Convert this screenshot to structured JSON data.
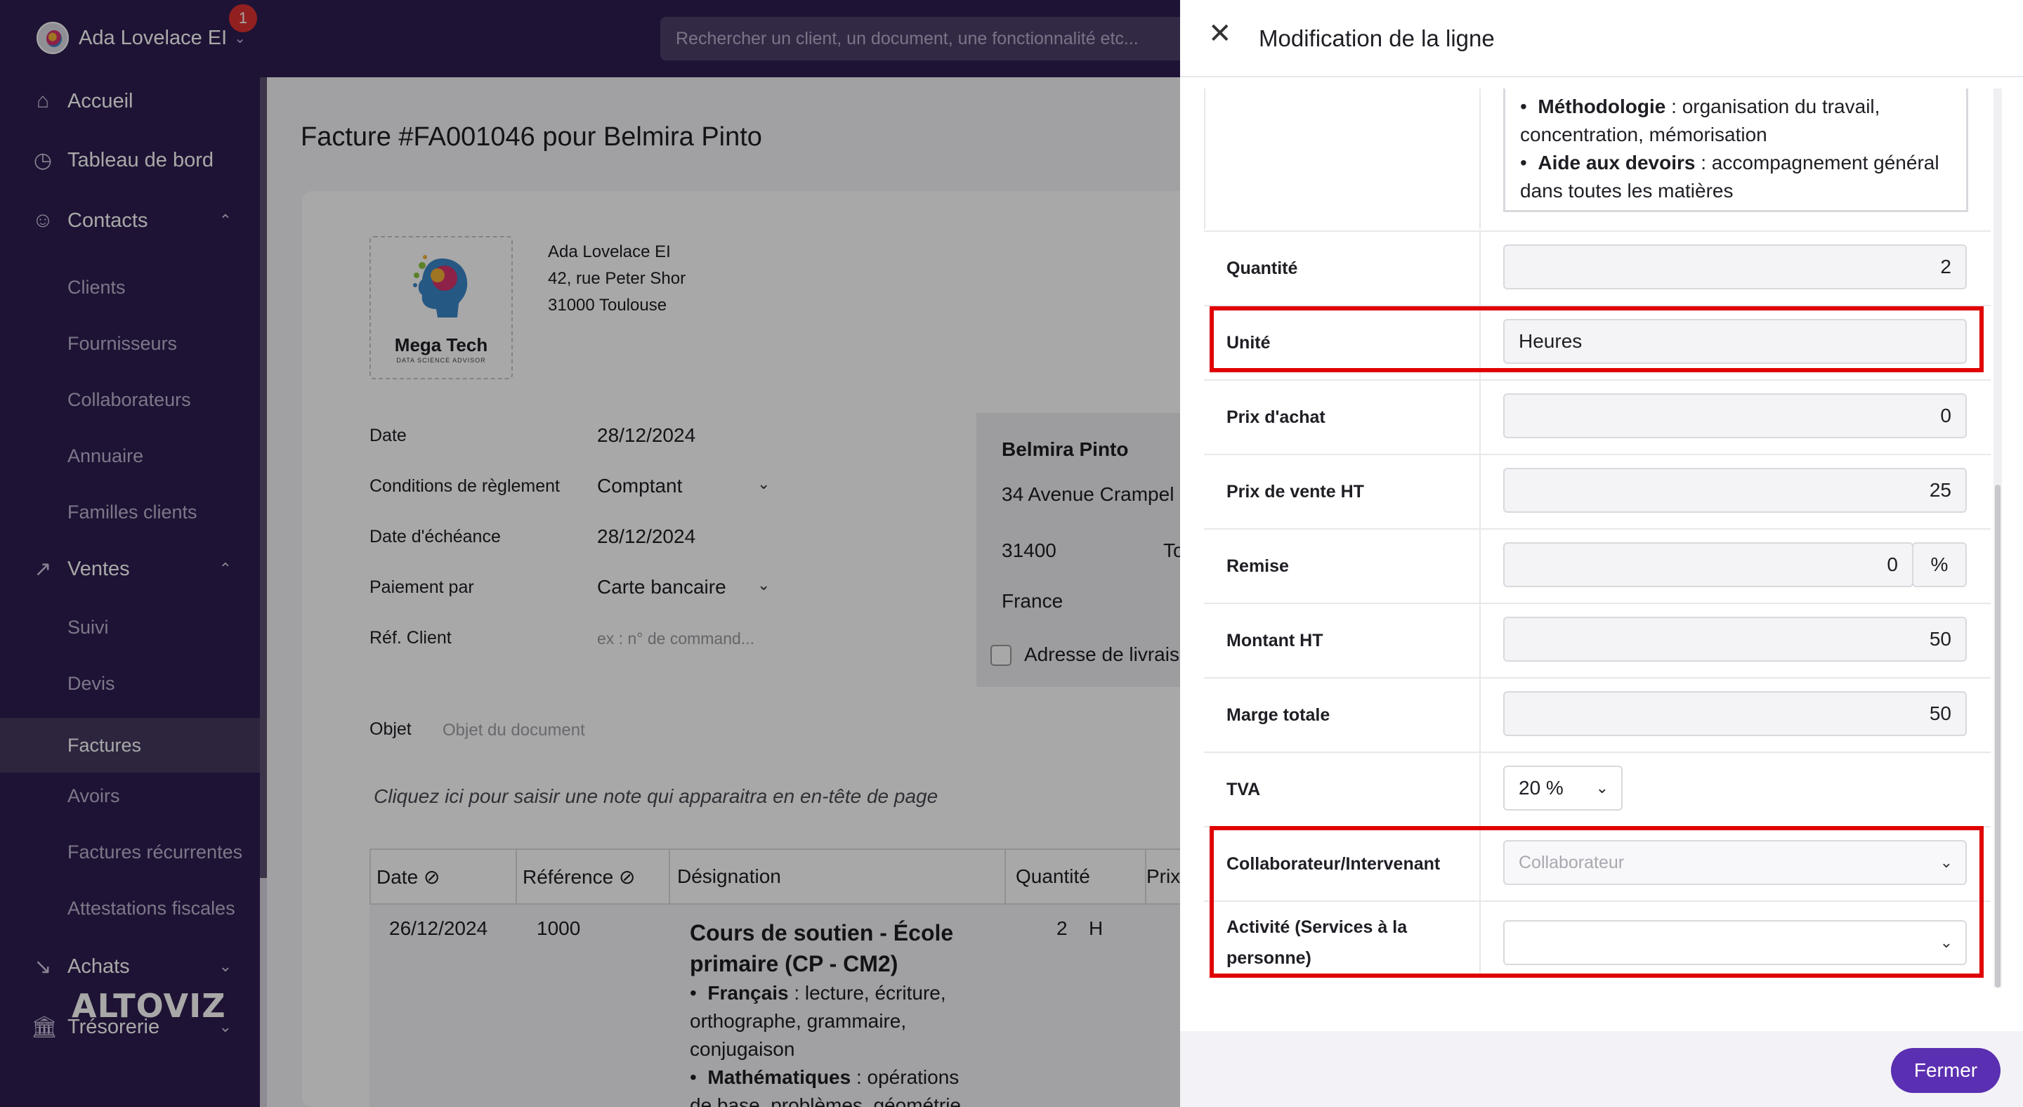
{
  "topbar": {
    "account_name": "Ada Lovelace EI",
    "notification_count": "1",
    "search_placeholder": "Rechercher un client, un document, une fonctionnalité etc..."
  },
  "sidebar": {
    "items": [
      {
        "label": "Accueil",
        "icon": "home-icon"
      },
      {
        "label": "Tableau de bord",
        "icon": "dashboard-icon"
      },
      {
        "label": "Contacts",
        "icon": "user-icon",
        "expanded": true
      },
      {
        "label": "Ventes",
        "icon": "trend-up-icon",
        "expanded": true
      },
      {
        "label": "Achats",
        "icon": "trend-down-icon",
        "expanded": false
      },
      {
        "label": "Trésorerie",
        "icon": "bank-icon",
        "expanded": false
      }
    ],
    "contacts_sub": [
      "Clients",
      "Fournisseurs",
      "Collaborateurs",
      "Annuaire",
      "Familles clients"
    ],
    "ventes_sub": [
      "Suivi",
      "Devis",
      "Factures",
      "Avoirs",
      "Factures récurrentes",
      "Attestations fiscales"
    ],
    "active": "Factures",
    "brand": "ALTOVIZ"
  },
  "invoice": {
    "title": "Facture #FA001046 pour Belmira Pinto",
    "logo_name": "Mega Tech",
    "logo_sub": "DATA SCIENCE ADVISOR",
    "company_lines": [
      "Ada Lovelace EI",
      "42, rue Peter Shor",
      "31000 Toulouse"
    ],
    "fields": {
      "date_label": "Date",
      "date_value": "28/12/2024",
      "conditions_label": "Conditions de règlement",
      "conditions_value": "Comptant",
      "echeance_label": "Date d'échéance",
      "echeance_value": "28/12/2024",
      "paiement_label": "Paiement par",
      "paiement_value": "Carte bancaire",
      "ref_label": "Réf. Client",
      "ref_placeholder": "ex : n° de command..."
    },
    "client": {
      "name": "Belmira Pinto",
      "street": "34 Avenue Crampel",
      "postal": "31400",
      "city": "To",
      "country": "France",
      "delivery_label": "Adresse de livrais"
    },
    "objet_label": "Objet",
    "objet_placeholder": "Objet du document",
    "note": "Cliquez ici pour saisir une note qui apparaitra en en-tête de page",
    "table": {
      "headers": [
        "Date",
        "Référence",
        "Désignation",
        "Quantité",
        "Prix"
      ],
      "row": {
        "date": "26/12/2024",
        "reference": "1000",
        "designation_title": "Cours de soutien - École primaire (CP - CM2)",
        "lines": [
          {
            "bullet": "•",
            "bold": "Français",
            "text": " : lecture, écriture,"
          },
          {
            "bullet": "",
            "bold": "",
            "text": "orthographe, grammaire,"
          },
          {
            "bullet": "",
            "bold": "",
            "text": "conjugaison"
          },
          {
            "bullet": "•",
            "bold": "Mathématiques",
            "text": " : opérations"
          },
          {
            "bullet": "",
            "bold": "",
            "text": "de base, problèmes, géométrie"
          }
        ],
        "quantity": "2",
        "unit_abbr": "H"
      }
    }
  },
  "panel": {
    "title": "Modification de la ligne",
    "description_lines": [
      {
        "bullet": "•",
        "bold": "Méthodologie",
        "text": " : organisation du travail,"
      },
      {
        "bullet": "",
        "bold": "",
        "text": "concentration, mémorisation"
      },
      {
        "bullet": "•",
        "bold": "Aide aux devoirs",
        "text": " : accompagnement général"
      },
      {
        "bullet": "",
        "bold": "",
        "text": "dans toutes les matières"
      }
    ],
    "fields": {
      "quantite_label": "Quantité",
      "quantite_value": "2",
      "unite_label": "Unité",
      "unite_value": "Heures",
      "prix_achat_label": "Prix d'achat",
      "prix_achat_value": "0",
      "prix_vente_label": "Prix de vente HT",
      "prix_vente_value": "25",
      "remise_label": "Remise",
      "remise_value": "0",
      "remise_unit": "%",
      "montant_label": "Montant HT",
      "montant_value": "50",
      "marge_label": "Marge totale",
      "marge_value": "50",
      "tva_label": "TVA",
      "tva_value": "20 %",
      "collab_label": "Collaborateur/Intervenant",
      "collab_placeholder": "Collaborateur",
      "activite_label_1": "Activité (Services à la",
      "activite_label_2": "personne)",
      "activite_value": ""
    },
    "close_button": "Fermer",
    "highlight_color": "#e00000"
  }
}
